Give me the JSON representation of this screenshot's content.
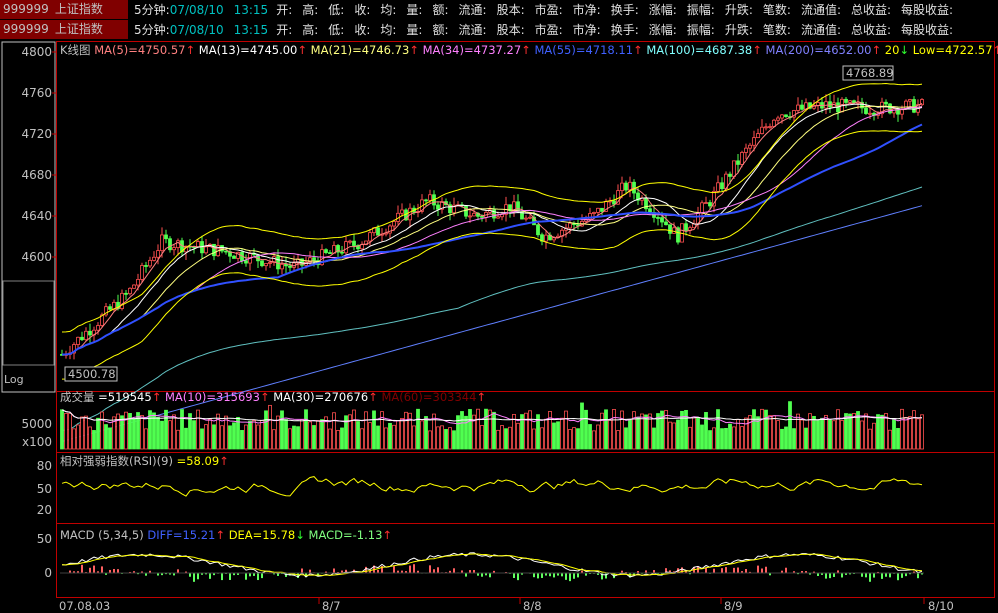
{
  "header": {
    "rows": [
      {
        "code": "999999",
        "name": "上证指数",
        "period": "5分钟:",
        "date": "07/08/10",
        "time": "13:15"
      },
      {
        "code": "999999",
        "name": "上证指数",
        "period": "5分钟:",
        "date": "07/08/10",
        "time": "13:15"
      }
    ],
    "fields": [
      "开:",
      "高:",
      "低:",
      "收:",
      "均:",
      "量:",
      "额:",
      "流通:",
      "股本:",
      "市盈:",
      "市净:",
      "换手:",
      "涨幅:",
      "振幅:",
      "升跌:",
      "笔数:",
      "流通值:",
      "总收益:",
      "每股收益:"
    ]
  },
  "sidebar": {
    "log_label": "Log"
  },
  "price_panel": {
    "title": "K线图",
    "indicators": [
      {
        "text": "MA(5)=4750.57",
        "color": "#ff8080",
        "arrow": "up"
      },
      {
        "text": "MA(13)=4745.00",
        "color": "#ffffff",
        "arrow": "up"
      },
      {
        "text": "MA(21)=4746.73",
        "color": "#ffff80",
        "arrow": "up"
      },
      {
        "text": "MA(34)=4737.27",
        "color": "#ff80ff",
        "arrow": "up"
      },
      {
        "text": "MA(55)=4718.11",
        "color": "#4060ff",
        "arrow": "up"
      },
      {
        "text": "MA(100)=4687.38",
        "color": "#80ffff",
        "arrow": "up"
      },
      {
        "text": "MA(200)=4652.00",
        "color": "#8080ff",
        "arrow": "up"
      },
      {
        "text": "20",
        "color": "#ffff00",
        "arrow": "down"
      },
      {
        "text": "Low=4722.57",
        "color": "#ffff00",
        "arrow": "up"
      }
    ],
    "high_label": "4768.89",
    "low_label": "4500.78",
    "y_ticks": [
      "4800",
      "4760",
      "4720",
      "4680",
      "4640",
      "4600"
    ]
  },
  "volume_panel": {
    "title": "成交量",
    "indicators": [
      {
        "text": "=519545",
        "color": "#ffffff",
        "arrow": "up"
      },
      {
        "text": "MA(10)=315693",
        "color": "#ff80ff",
        "arrow": "up"
      },
      {
        "text": "MA(30)=270676",
        "color": "#ffffff",
        "arrow": "up"
      },
      {
        "text": "MA(60)=303344",
        "color": "#800000",
        "arrow": "up"
      }
    ],
    "y_ticks": [
      "5000"
    ],
    "unit": "x100"
  },
  "rsi_panel": {
    "title": "相对强弱指数(RSI)(9)",
    "indicators": [
      {
        "text": "=58.09",
        "color": "#ffff00",
        "arrow": "up"
      }
    ],
    "y_ticks": [
      "80",
      "50",
      "20"
    ]
  },
  "macd_panel": {
    "title": "MACD",
    "params": "(5,34,5)",
    "indicators": [
      {
        "text": "DIFF=15.21",
        "color": "#4060ff",
        "arrow": "up"
      },
      {
        "text": "DEA=15.78",
        "color": "#ffff00",
        "arrow": "down"
      },
      {
        "text": "MACD=-1.13",
        "color": "#80ff80",
        "arrow": "up"
      }
    ],
    "y_ticks": [
      "50",
      "0"
    ]
  },
  "x_axis": {
    "labels": [
      "07.08.03",
      "8/7",
      "8/8",
      "8/9",
      "8/10"
    ]
  },
  "colors": {
    "up": "#ff5050",
    "down": "#50ff50",
    "axis": "#c00000",
    "text": "#c0c0c0"
  }
}
